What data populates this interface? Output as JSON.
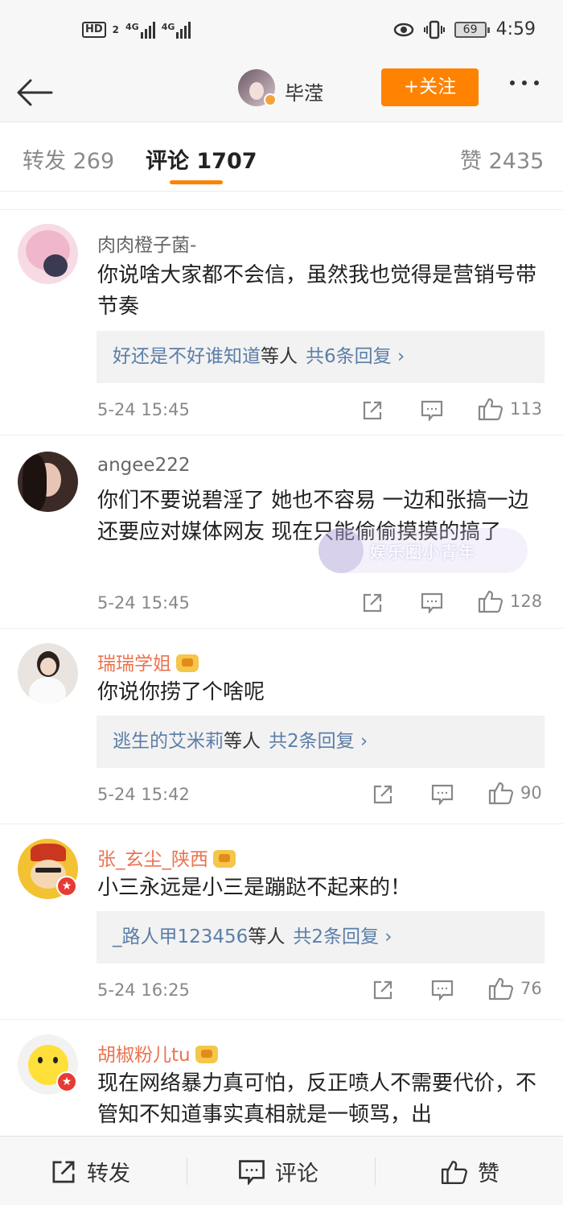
{
  "status_bar": {
    "network_hd": "HD",
    "network_hd_sub": "2",
    "signal1_label": "4G",
    "signal2_label": "4G",
    "battery": "69",
    "time": "4:59"
  },
  "header": {
    "user_name": "毕滢",
    "follow_label": "+关注"
  },
  "tabs": [
    {
      "label": "转发 269"
    },
    {
      "label": "评论 1707"
    },
    {
      "label": "赞 2435"
    }
  ],
  "comments": [
    {
      "name": "肉肉橙子菌-",
      "text": "你说啥大家都不会信，虽然我也觉得是营销号带节奏",
      "reply_who": "好还是不好谁知道",
      "reply_suffix": "等人",
      "reply_count": "共6条回复 ›",
      "time": "5-24 15:45",
      "likes": "113"
    },
    {
      "name": "angee222",
      "text": "你们不要说碧淫了 她也不容易 一边和张搞一边还要应对媒体网友 现在只能偷偷摸摸的搞了",
      "time": "5-24 15:45",
      "likes": "128"
    },
    {
      "name": "瑞瑞学姐",
      "text": "你说你捞了个啥呢",
      "reply_who": "逃生的艾米莉",
      "reply_suffix": "等人",
      "reply_count": "共2条回复 ›",
      "time": "5-24 15:42",
      "likes": "90"
    },
    {
      "name": "张_玄尘_陕西",
      "text": "小三永远是小三是蹦跶不起来的！",
      "reply_who": "_路人甲123456",
      "reply_suffix": "等人",
      "reply_count": "共2条回复 ›",
      "time": "5-24 16:25",
      "likes": "76"
    },
    {
      "name": "胡椒粉儿tu",
      "text": "现在网络暴力真可怕，反正喷人不需要代价，不管知不知道事实真相就是一顿骂，出"
    }
  ],
  "watermark": "娱乐圈小青年",
  "bottom_bar": {
    "repost_label": "转发",
    "comment_label": "评论",
    "like_label": "赞"
  },
  "colors": {
    "accent": "#ff8200",
    "vip_name": "#eb7350",
    "link": "#5b7ea8"
  }
}
